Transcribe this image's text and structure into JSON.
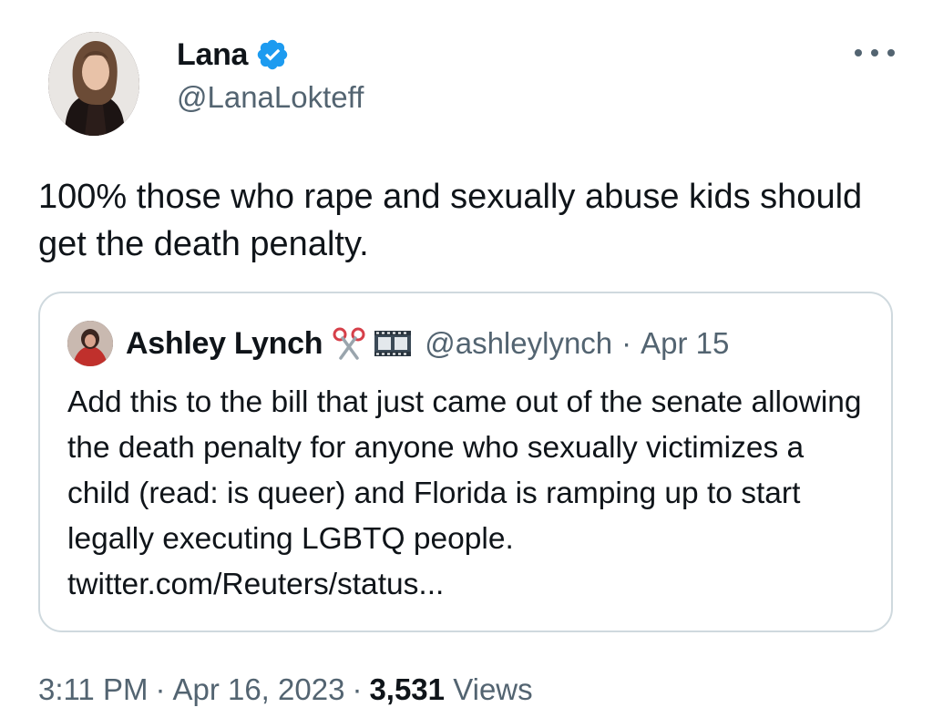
{
  "author": {
    "name": "Lana",
    "handle": "@LanaLokteff",
    "verified": true,
    "verified_color": "#1d9bf0"
  },
  "tweet": {
    "text": "100% those who rape and sexually abuse kids should get the death penalty."
  },
  "quote": {
    "name": "Ashley Lynch",
    "name_emoji_icons": [
      "scissors-icon",
      "film-frames-icon"
    ],
    "handle": "@ashleylynch",
    "separator": "·",
    "date": "Apr 15",
    "text": "Add this to the bill that just came out of the senate allowing the death penalty for anyone who sexually victimizes a child (read: is queer) and Florida is ramping up to  start legally executing LGBTQ people. twitter.com/Reuters/status..."
  },
  "meta": {
    "time": "3:11 PM",
    "date": "Apr 16, 2023",
    "views_count": "3,531",
    "views_label": "Views",
    "separator": "·"
  },
  "colors": {
    "text": "#0f1419",
    "secondary": "#536471",
    "border": "#cfd9de"
  }
}
